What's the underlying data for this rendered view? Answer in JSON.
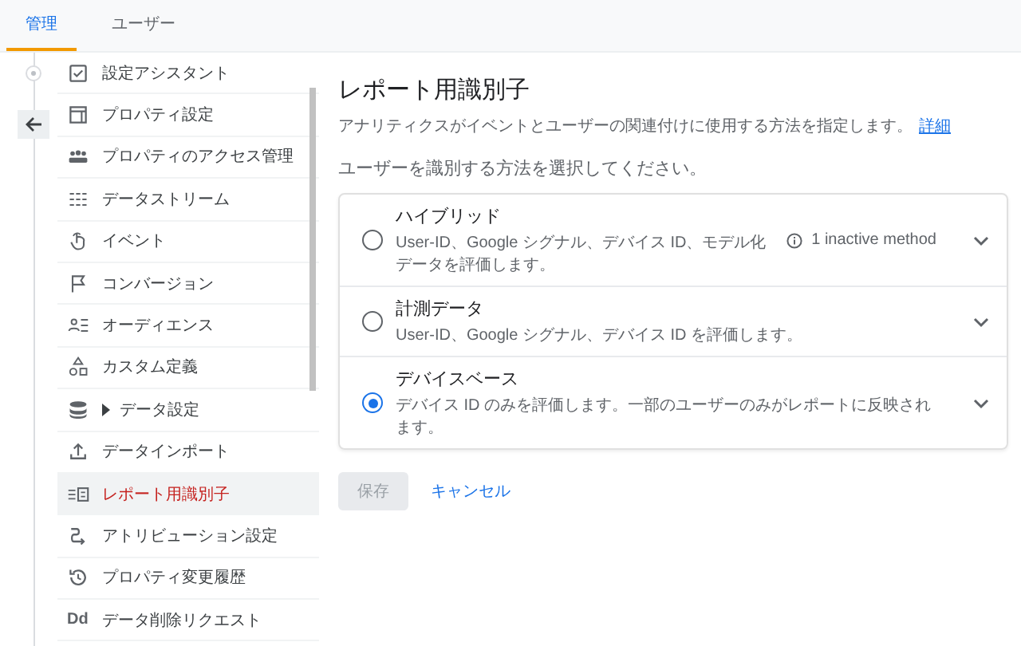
{
  "tabs": [
    {
      "label": "管理",
      "selected": true
    },
    {
      "label": "ユーザー",
      "selected": false
    }
  ],
  "sidebar": {
    "items": [
      {
        "label": "設定アシスタント",
        "selected": false,
        "kind": "link"
      },
      {
        "label": "プロパティ設定",
        "selected": false,
        "kind": "link"
      },
      {
        "label": "プロパティのアクセス管理",
        "selected": false,
        "kind": "link"
      },
      {
        "label": "データストリーム",
        "selected": false,
        "kind": "link"
      },
      {
        "label": "イベント",
        "selected": false,
        "kind": "link"
      },
      {
        "label": "コンバージョン",
        "selected": false,
        "kind": "link"
      },
      {
        "label": "オーディエンス",
        "selected": false,
        "kind": "link"
      },
      {
        "label": "カスタム定義",
        "selected": false,
        "kind": "link"
      },
      {
        "label": "データ設定",
        "selected": false,
        "kind": "group"
      },
      {
        "label": "データインポート",
        "selected": false,
        "kind": "link"
      },
      {
        "label": "レポート用識別子",
        "selected": true,
        "kind": "link"
      },
      {
        "label": "アトリビューション設定",
        "selected": false,
        "kind": "link"
      },
      {
        "label": "プロパティ変更履歴",
        "selected": false,
        "kind": "link"
      },
      {
        "label": "データ削除リクエスト",
        "selected": false,
        "kind": "link",
        "icon_text": "Dd"
      }
    ]
  },
  "main": {
    "title": "レポート用識別子",
    "description": "アナリティクスがイベントとユーザーの関連付けに使用する方法を指定します。",
    "link": "詳細",
    "prompt": "ユーザーを識別する方法を選択してください。",
    "options": [
      {
        "title": "ハイブリッド",
        "description": "User-ID、Google シグナル、デバイス ID、モデル化データを評価します。",
        "note": "1 inactive method",
        "selected": false
      },
      {
        "title": "計測データ",
        "description": "User-ID、Google シグナル、デバイス ID を評価します。",
        "selected": false
      },
      {
        "title": "デバイスベース",
        "description": "デバイス ID のみを評価します。一部のユーザーのみがレポートに反映されます。",
        "selected": true
      }
    ],
    "save_button": {
      "label": "保存",
      "disabled": true
    },
    "cancel_button": {
      "label": "キャンセル"
    }
  }
}
